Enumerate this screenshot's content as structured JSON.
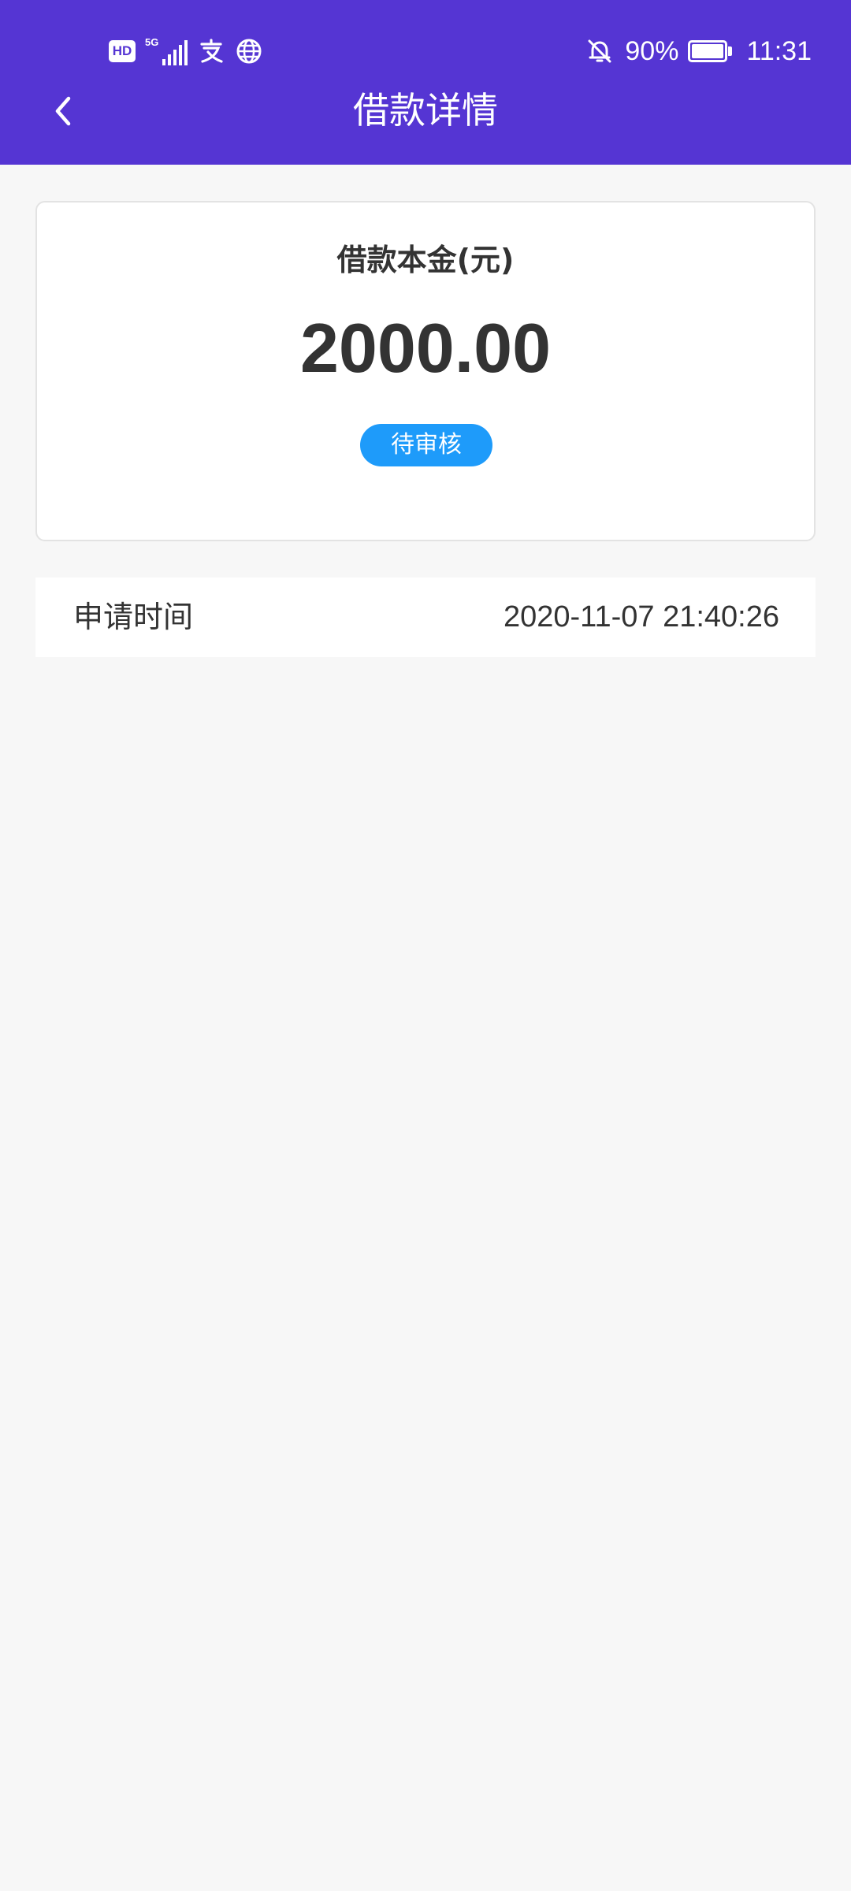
{
  "status_bar": {
    "hd": "HD",
    "network": "5G",
    "battery_percent": "90%",
    "battery_level": 0.9,
    "time": "11:31",
    "icons": [
      "hd-icon",
      "signal-icon",
      "alipay-icon",
      "globe-icon",
      "bell-off-icon",
      "battery-icon"
    ]
  },
  "header": {
    "title": "借款详情",
    "back_icon": "chevron-left-icon",
    "background": "#5535d3"
  },
  "card": {
    "label": "借款本金(元)",
    "amount": "2000.00",
    "status": "待审核",
    "status_color": "#1e9bfa"
  },
  "details": [
    {
      "label": "申请时间",
      "value": "2020-11-07 21:40:26"
    }
  ]
}
